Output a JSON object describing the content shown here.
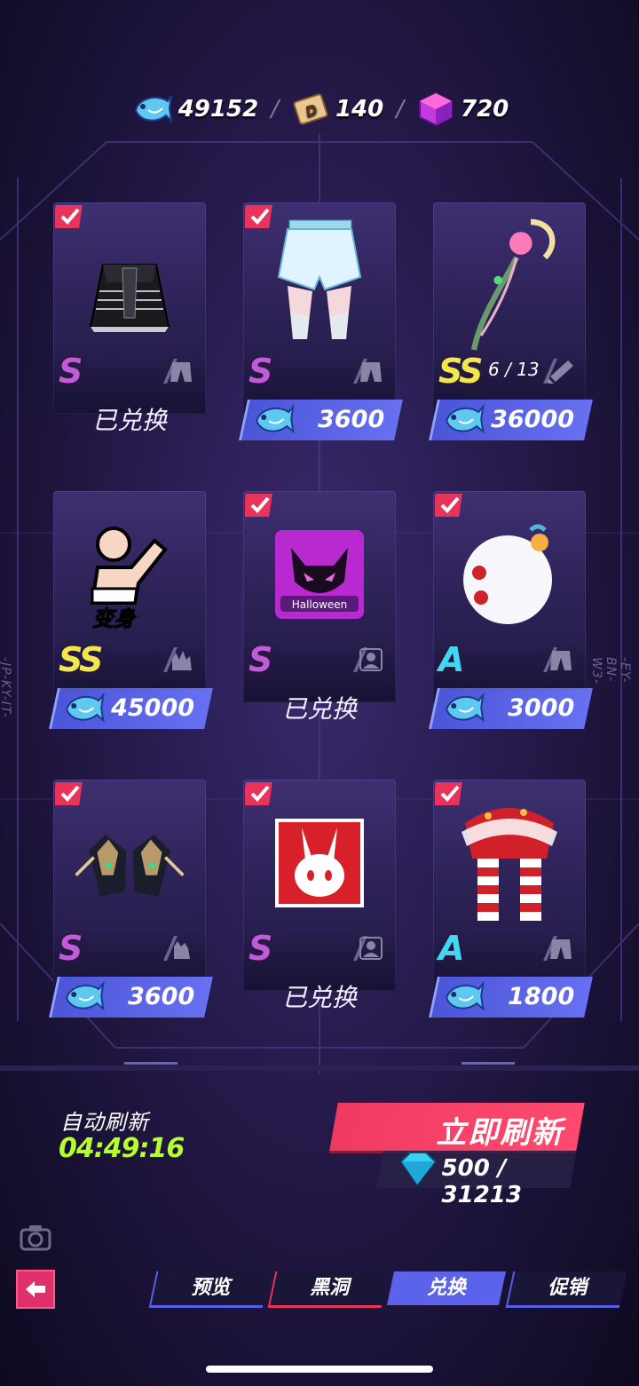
{
  "currencies": [
    {
      "name": "fish-currency",
      "value": "49152"
    },
    {
      "name": "d-ticket",
      "value": "140"
    },
    {
      "name": "cube-currency",
      "value": "720"
    }
  ],
  "separator": "/",
  "cards": [
    {
      "rarity": "S",
      "checked": true,
      "slot": "pants",
      "status": "已兑换",
      "price": null,
      "progress": null,
      "item": "black-skirt"
    },
    {
      "rarity": "S",
      "checked": true,
      "slot": "pants",
      "status": null,
      "price": "3600",
      "progress": null,
      "item": "white-shorts"
    },
    {
      "rarity": "SS",
      "checked": false,
      "slot": "weapon",
      "status": null,
      "price": "36000",
      "progress": "6 / 13",
      "item": "magic-staff"
    },
    {
      "rarity": "SS",
      "checked": false,
      "slot": "emote",
      "status": null,
      "price": "45000",
      "progress": null,
      "item": "transform-emote",
      "item_label": "变身"
    },
    {
      "rarity": "S",
      "checked": true,
      "slot": "avatar",
      "status": "已兑换",
      "price": null,
      "progress": null,
      "item": "halloween-avatar",
      "item_label": "Halloween"
    },
    {
      "rarity": "A",
      "checked": true,
      "slot": "pants",
      "status": null,
      "price": "3000",
      "progress": null,
      "item": "snowball-outfit"
    },
    {
      "rarity": "S",
      "checked": true,
      "slot": "gloves",
      "status": null,
      "price": "3600",
      "progress": null,
      "item": "rabbit-gloves"
    },
    {
      "rarity": "S",
      "checked": true,
      "slot": "avatar",
      "status": "已兑换",
      "price": null,
      "progress": null,
      "item": "rabbit-mask-avatar"
    },
    {
      "rarity": "A",
      "checked": true,
      "slot": "pants",
      "status": null,
      "price": "1800",
      "progress": null,
      "item": "striped-pants"
    }
  ],
  "auto_refresh": {
    "label": "自动刷新",
    "timer": "04:49:16"
  },
  "refresh_now": {
    "label": "立即刷新",
    "cost": "500 / 31213"
  },
  "tabs": [
    {
      "label": "预览",
      "style": "normal"
    },
    {
      "label": "黑洞",
      "style": "red"
    },
    {
      "label": "兑换",
      "style": "active"
    },
    {
      "label": "促销",
      "style": "normal"
    }
  ],
  "side_left": "-JP-KY-IT-",
  "side_right": "-EY-BN-W3-",
  "colors": {
    "accent_blue": "#5a63ea",
    "accent_red": "#f03a60",
    "timer_green": "#b6ff2a"
  }
}
